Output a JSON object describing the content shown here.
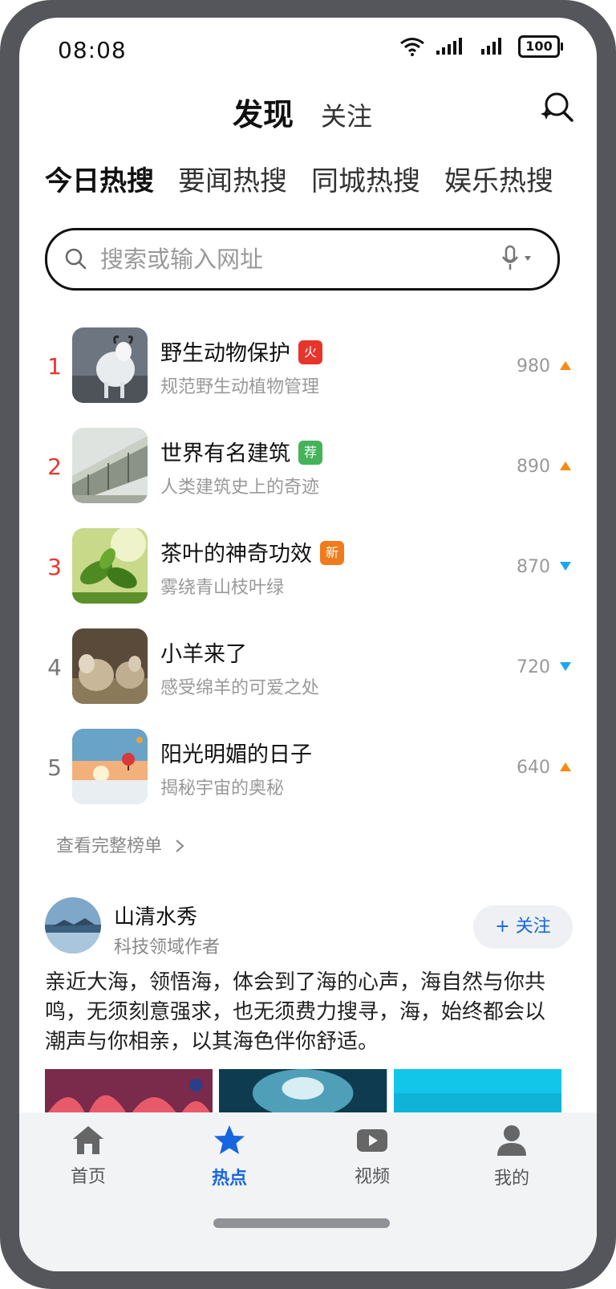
{
  "status_bar": {
    "time": "08:08",
    "battery": "100"
  },
  "header": {
    "title": "发现",
    "follow_tab": "关注"
  },
  "category_tabs": [
    {
      "label": "今日热搜",
      "active": true
    },
    {
      "label": "要闻热搜",
      "active": false
    },
    {
      "label": "同城热搜",
      "active": false
    },
    {
      "label": "娱乐热搜",
      "active": false
    }
  ],
  "search": {
    "placeholder": "搜索或输入网址"
  },
  "hot_list": {
    "items": [
      {
        "rank": "1",
        "title": "野生动物保护",
        "tag": "火",
        "tag_color": "#e8352b",
        "subtitle": "规范野生动植物管理",
        "score": "980",
        "trend": "up"
      },
      {
        "rank": "2",
        "title": "世界有名建筑",
        "tag": "荐",
        "tag_color": "#44b35a",
        "subtitle": "人类建筑史上的奇迹",
        "score": "890",
        "trend": "up"
      },
      {
        "rank": "3",
        "title": "茶叶的神奇功效",
        "tag": "新",
        "tag_color": "#f07b1c",
        "subtitle": "雾绕青山枝叶绿",
        "score": "870",
        "trend": "down"
      },
      {
        "rank": "4",
        "title": "小羊来了",
        "tag": "",
        "subtitle": "感受绵羊的可爱之处",
        "score": "720",
        "trend": "down"
      },
      {
        "rank": "5",
        "title": "阳光明媚的日子",
        "tag": "",
        "subtitle": "揭秘宇宙的奥秘",
        "score": "640",
        "trend": "up"
      }
    ],
    "view_all": "查看完整榜单"
  },
  "post": {
    "author_name": "山清水秀",
    "author_desc": "科技领域作者",
    "follow_button": "+ 关注",
    "text": "亲近大海，领悟海，体会到了海的心声，海自然与你共鸣，无须刻意强求，也无须费力搜寻，海，始终都会以潮声与你相亲，以其海色伴你舒适。"
  },
  "bottom_nav": [
    {
      "label": "首页",
      "icon": "home-icon",
      "active": false
    },
    {
      "label": "热点",
      "icon": "star-icon",
      "active": true
    },
    {
      "label": "视频",
      "icon": "video-icon",
      "active": false
    },
    {
      "label": "我的",
      "icon": "profile-icon",
      "active": false
    }
  ],
  "colors": {
    "accent": "#1766e0",
    "hot_red": "#e8352b",
    "trend_up": "#f78a12",
    "trend_down": "#1da6f0"
  }
}
